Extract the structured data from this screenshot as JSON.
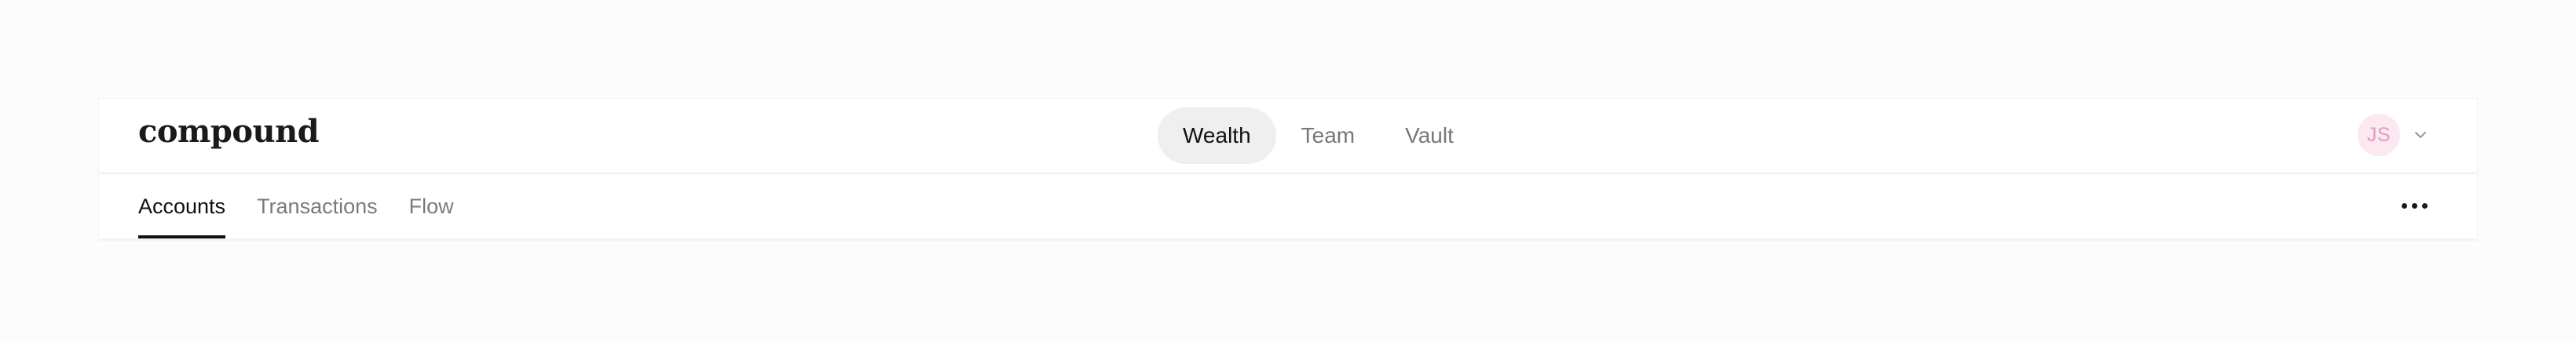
{
  "app": {
    "logo_text": "compound"
  },
  "main_nav": {
    "items": [
      {
        "label": "Wealth",
        "active": true
      },
      {
        "label": "Team",
        "active": false
      },
      {
        "label": "Vault",
        "active": false
      }
    ]
  },
  "user": {
    "initials": "JS",
    "avatar_bg": "#fbe8f1",
    "avatar_fg": "#e39bbf",
    "menu_icon": "chevron-down-icon"
  },
  "sub_nav": {
    "tabs": [
      {
        "label": "Accounts",
        "active": true
      },
      {
        "label": "Transactions",
        "active": false
      },
      {
        "label": "Flow",
        "active": false
      }
    ],
    "more_icon": "more-horizontal-icon"
  },
  "colors": {
    "page_bg": "#fcfcfc",
    "active_pill_bg": "#efefef",
    "active_text": "#111111",
    "inactive_text": "#777777"
  }
}
